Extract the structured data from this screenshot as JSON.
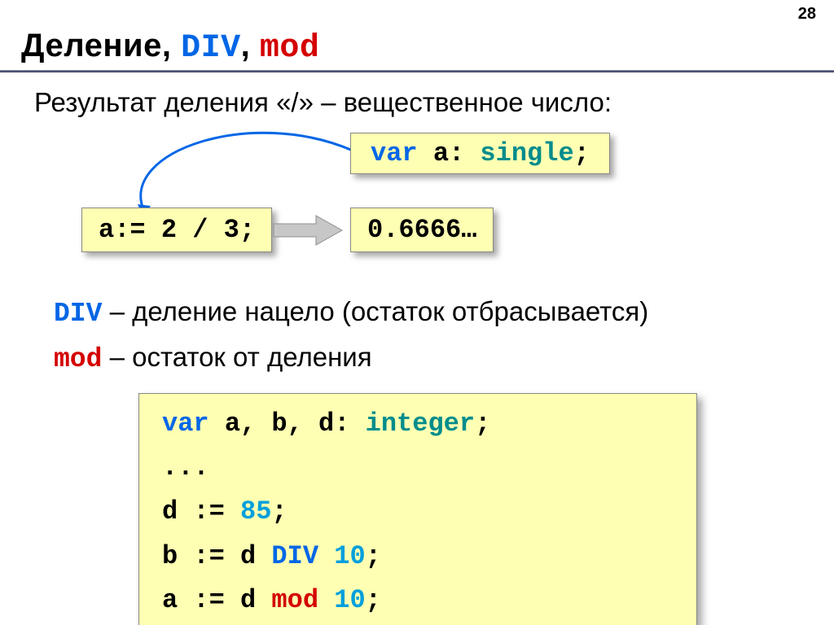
{
  "pagenum": "28",
  "title": {
    "word": "Деление",
    "kw1": "DIV",
    "kw2": "mod",
    "comma": ","
  },
  "intro": "Результат деления «/» – вещественное число:",
  "row1": {
    "var_box": {
      "kw_var": "var",
      "rest": " a: ",
      "type": "single",
      "semi": ";"
    },
    "expr_box": "a:= 2 / 3;",
    "result_box": "0.6666…"
  },
  "defs": {
    "div": {
      "kw": "DIV",
      "text": " – деление нацело (остаток отбрасывается)"
    },
    "mod": {
      "kw": "mod",
      "text": " – остаток от деления"
    }
  },
  "code": {
    "l1": {
      "kw_var": "var",
      "mid": " a, b, d: ",
      "type": "integer",
      "semi": ";"
    },
    "l2": "...",
    "l3": {
      "pre": "d := ",
      "num": "85",
      "semi": ";"
    },
    "l4": {
      "pre": "b := d ",
      "op": "DIV",
      "sp": " ",
      "num": "10",
      "semi": ";"
    },
    "l5": {
      "pre": "a := d ",
      "op": "mod",
      "sp": " ",
      "num": "10",
      "semi": ";"
    }
  }
}
